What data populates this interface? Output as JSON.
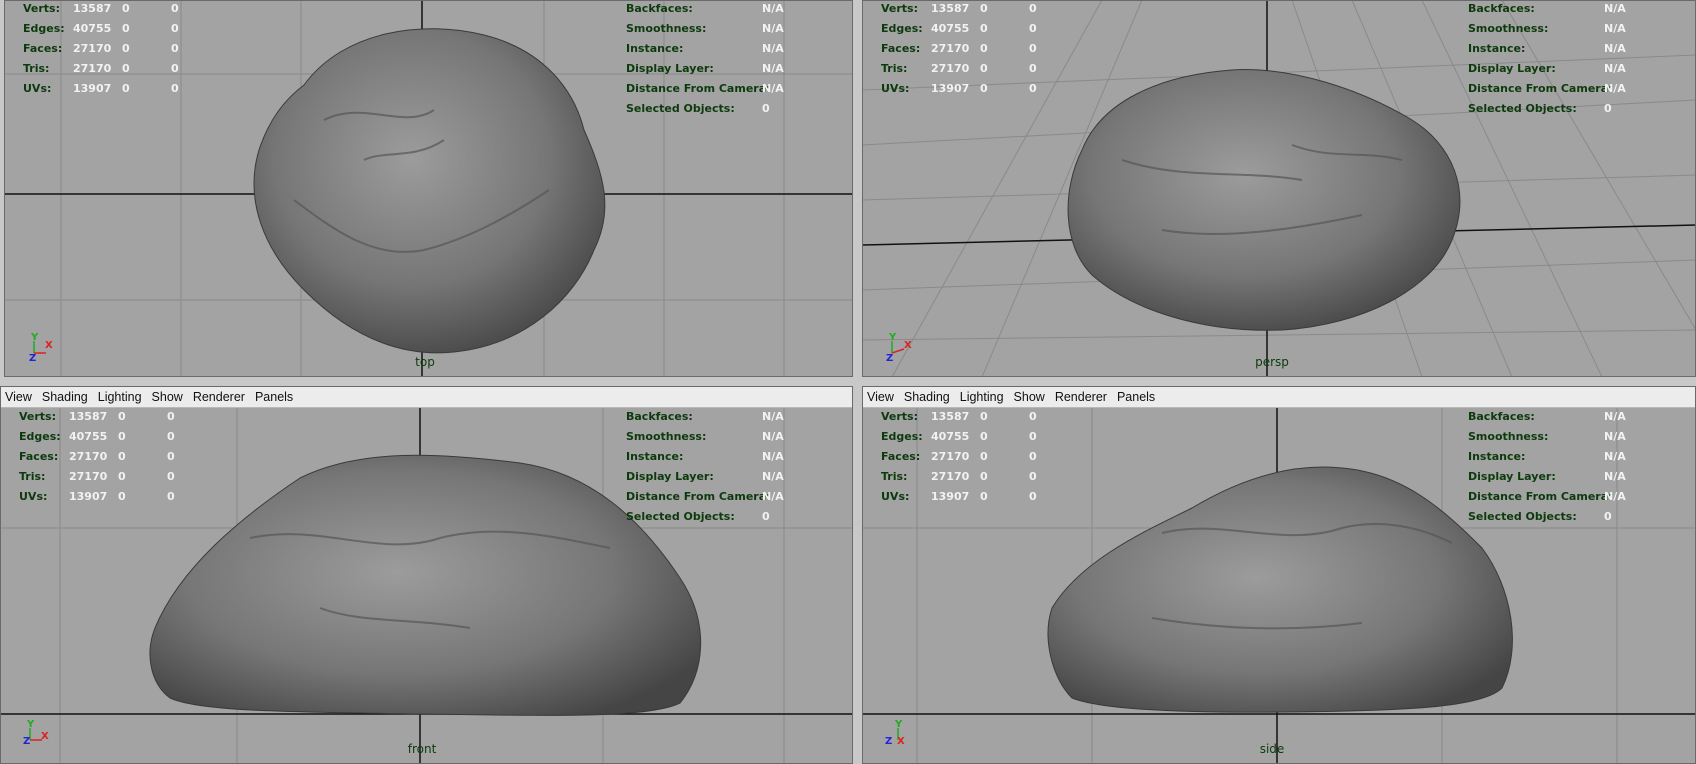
{
  "menu": [
    "View",
    "Shading",
    "Lighting",
    "Show",
    "Renderer",
    "Panels"
  ],
  "stats": [
    {
      "label": "Verts:",
      "v1": "13587",
      "v2": "0",
      "v3": "0"
    },
    {
      "label": "Edges:",
      "v1": "40755",
      "v2": "0",
      "v3": "0"
    },
    {
      "label": "Faces:",
      "v1": "27170",
      "v2": "0",
      "v3": "0"
    },
    {
      "label": "Tris:",
      "v1": "27170",
      "v2": "0",
      "v3": "0"
    },
    {
      "label": "UVs:",
      "v1": "13907",
      "v2": "0",
      "v3": "0"
    }
  ],
  "info": [
    {
      "label": "Backfaces:",
      "value": "N/A"
    },
    {
      "label": "Smoothness:",
      "value": "N/A"
    },
    {
      "label": "Instance:",
      "value": "N/A"
    },
    {
      "label": "Display Layer:",
      "value": "N/A"
    },
    {
      "label": "Distance From Camera:",
      "value": "N/A"
    },
    {
      "label": "Selected Objects:",
      "value": "0"
    }
  ],
  "viewports": {
    "top": {
      "camera": "top"
    },
    "persp": {
      "camera": "persp"
    },
    "front": {
      "camera": "front"
    },
    "side": {
      "camera": "side"
    }
  },
  "colors": {
    "grid": "#8c8c8c",
    "axis": "#111111",
    "hud_label": "#0d3a0d",
    "hud_value": "#f2f2f2",
    "bg": "#a3a3a3"
  }
}
